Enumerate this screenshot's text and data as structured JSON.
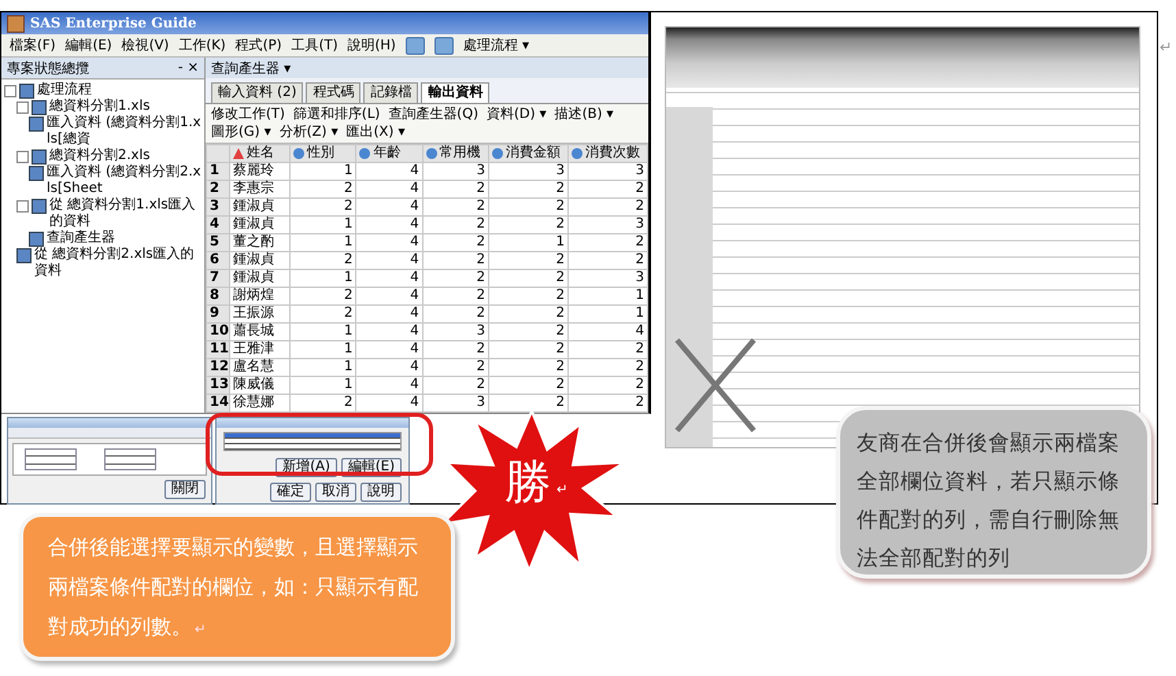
{
  "app": {
    "title": "SAS Enterprise Guide",
    "menu": [
      "檔案(F)",
      "編輯(E)",
      "檢視(V)",
      "工作(K)",
      "程式(P)",
      "工具(T)",
      "說明(H)"
    ],
    "toolbar_label": "處理流程 ▾",
    "pane_title": "專案狀態總攬",
    "pane_close": "- ×",
    "tree": [
      {
        "label": "處理流程",
        "children": [
          {
            "label": "總資料分割1.xls",
            "children": [
              {
                "label": "匯入資料 (總資料分割1.xls[總資"
              }
            ]
          },
          {
            "label": "總資料分割2.xls",
            "children": [
              {
                "label": "匯入資料 (總資料分割2.xls[Sheet"
              }
            ]
          },
          {
            "label": "從 總資料分割1.xls匯入的資料",
            "children": [
              {
                "label": "查詢產生器"
              }
            ]
          },
          {
            "label": "從 總資料分割2.xls匯入的資料"
          }
        ]
      }
    ],
    "flow_title": "查詢產生器 ▾",
    "tabs": [
      {
        "label": "輸入資料 (2)",
        "selected": false
      },
      {
        "label": "程式碼",
        "selected": false
      },
      {
        "label": "記錄檔",
        "selected": false
      },
      {
        "label": "輸出資料",
        "selected": true
      }
    ],
    "actions": [
      "修改工作(T)",
      "篩選和排序(L)",
      "查詢產生器(Q)",
      "資料(D) ▾",
      "描述(B) ▾",
      "圖形(G) ▾",
      "分析(Z) ▾",
      "匯出(X) ▾"
    ],
    "columns": [
      {
        "name": "姓名",
        "kind": "text"
      },
      {
        "name": "性別",
        "kind": "number"
      },
      {
        "name": "年齡",
        "kind": "number"
      },
      {
        "name": "常用機",
        "kind": "number"
      },
      {
        "name": "消費金額",
        "kind": "number"
      },
      {
        "name": "消費次數",
        "kind": "number"
      }
    ],
    "rows": [
      {
        "number": "1",
        "cells": [
          "蔡麗玲",
          "1",
          "4",
          "3",
          "3",
          "3"
        ]
      },
      {
        "number": "2",
        "cells": [
          "李惠宗",
          "2",
          "4",
          "2",
          "2",
          "2"
        ]
      },
      {
        "number": "3",
        "cells": [
          "鍾淑貞",
          "2",
          "4",
          "2",
          "2",
          "2"
        ]
      },
      {
        "number": "4",
        "cells": [
          "鍾淑貞",
          "1",
          "4",
          "2",
          "2",
          "3"
        ]
      },
      {
        "number": "5",
        "cells": [
          "董之酌",
          "1",
          "4",
          "2",
          "1",
          "2"
        ]
      },
      {
        "number": "6",
        "cells": [
          "鍾淑貞",
          "2",
          "4",
          "2",
          "2",
          "2"
        ]
      },
      {
        "number": "7",
        "cells": [
          "鍾淑貞",
          "1",
          "4",
          "2",
          "2",
          "3"
        ]
      },
      {
        "number": "8",
        "cells": [
          "謝炳煌",
          "2",
          "4",
          "2",
          "2",
          "1"
        ]
      },
      {
        "number": "9",
        "cells": [
          "王振源",
          "2",
          "4",
          "2",
          "2",
          "1"
        ]
      },
      {
        "number": "10",
        "cells": [
          "蕭長城",
          "1",
          "4",
          "3",
          "2",
          "4"
        ]
      },
      {
        "number": "11",
        "cells": [
          "王雅津",
          "1",
          "4",
          "2",
          "2",
          "2"
        ]
      },
      {
        "number": "12",
        "cells": [
          "盧名慧",
          "1",
          "4",
          "2",
          "2",
          "2"
        ]
      },
      {
        "number": "13",
        "cells": [
          "陳威儀",
          "1",
          "4",
          "2",
          "2",
          "2"
        ]
      },
      {
        "number": "14",
        "cells": [
          "徐慧娜",
          "2",
          "4",
          "3",
          "2",
          "2"
        ]
      }
    ]
  },
  "join_dialog": {
    "close_button": "關閉"
  },
  "properties_dialog": {
    "side_buttons": [
      "新增(A)",
      "編輯(E)"
    ],
    "buttons": [
      "確定",
      "取消",
      "說明"
    ]
  },
  "burst": {
    "label": "勝",
    "mark": "↵"
  },
  "page_mark": "↵",
  "gray_callout": {
    "text": "友商在合併後會顯示兩檔案全部欄位資料，若只顯示條件配對的列，需自行刪除無法全部配對的列"
  },
  "orange_callout": {
    "text": "合併後能選擇要顯示的變數，且選擇顯示兩檔案條件配對的欄位，如：只顯示有配對成功的列數。",
    "mark": "↵"
  }
}
